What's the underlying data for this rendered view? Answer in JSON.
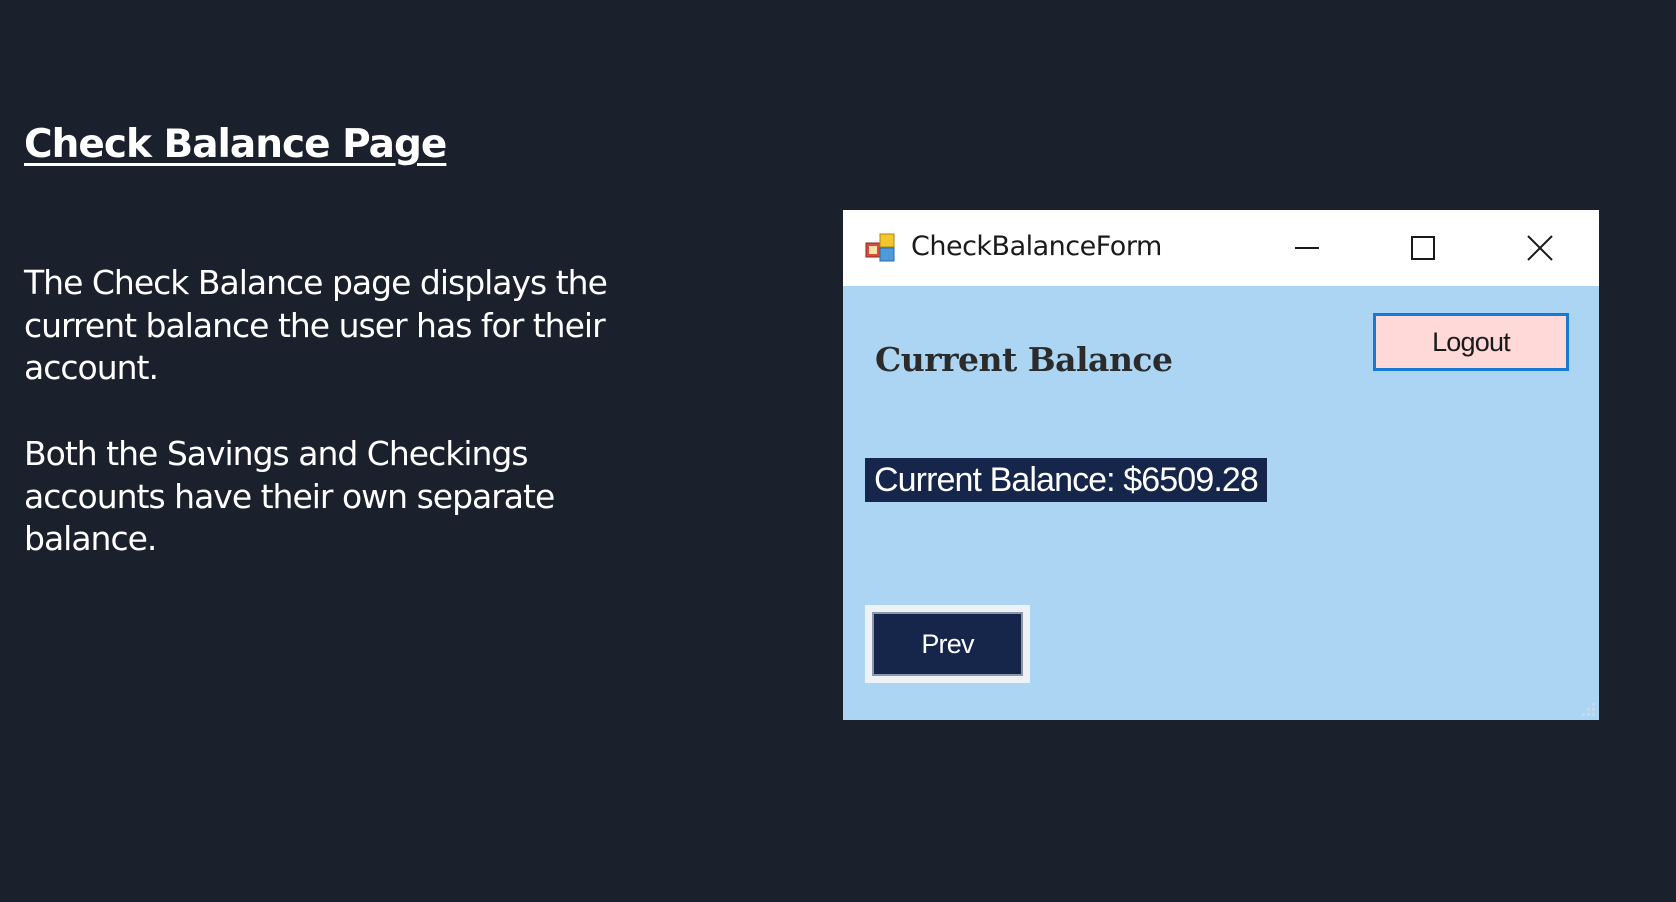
{
  "slide": {
    "title": "Check Balance Page",
    "paragraphs": [
      "The Check Balance page displays the current balance the user has for their account.",
      "Both the Savings and Checkings accounts have their own separate balance."
    ]
  },
  "window": {
    "title": "CheckBalanceForm",
    "icon": "winforms-app-icon",
    "controls": {
      "minimize_icon": "minimize-icon",
      "maximize_icon": "maximize-icon",
      "close_icon": "close-icon"
    }
  },
  "form": {
    "heading": "Current Balance",
    "logout_label": "Logout",
    "balance_text": "Current Balance: $6509.28",
    "prev_label": "Prev"
  },
  "colors": {
    "slide_background": "#1b202d",
    "form_background": "#acd4f3",
    "label_background": "#16254a",
    "logout_background": "#ffd8d8",
    "logout_border": "#1779d3"
  }
}
